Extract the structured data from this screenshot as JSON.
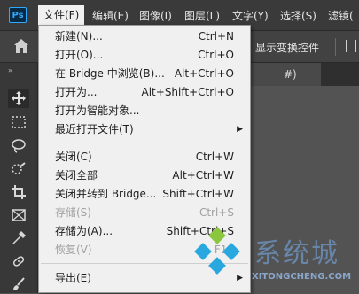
{
  "app": {
    "logo_text": "Ps",
    "menu": [
      "文件(F)",
      "编辑(E)",
      "图像(I)",
      "图层(L)",
      "文字(Y)",
      "选择(S)",
      "滤镜("
    ]
  },
  "options_bar": {
    "show_transform_controls": "显示变换控件"
  },
  "tab": {
    "label": "#)"
  },
  "file_menu": {
    "items": [
      {
        "label": "新建(N)...",
        "shortcut": "Ctrl+N",
        "disabled": false
      },
      {
        "label": "打开(O)...",
        "shortcut": "Ctrl+O",
        "disabled": false
      },
      {
        "label": "在 Bridge 中浏览(B)...",
        "shortcut": "Alt+Ctrl+O",
        "disabled": false
      },
      {
        "label": "打开为...",
        "shortcut": "Alt+Shift+Ctrl+O",
        "disabled": false
      },
      {
        "label": "打开为智能对象...",
        "shortcut": "",
        "disabled": false
      },
      {
        "label": "最近打开文件(T)",
        "shortcut": "",
        "disabled": false,
        "submenu": true
      },
      {
        "label": "关闭(C)",
        "shortcut": "Ctrl+W",
        "disabled": false
      },
      {
        "label": "关闭全部",
        "shortcut": "Alt+Ctrl+W",
        "disabled": false
      },
      {
        "label": "关闭并转到 Bridge...",
        "shortcut": "Shift+Ctrl+W",
        "disabled": false
      },
      {
        "label": "存储(S)",
        "shortcut": "Ctrl+S",
        "disabled": true
      },
      {
        "label": "存储为(A)...",
        "shortcut": "Shift+Ctrl+S",
        "disabled": false
      },
      {
        "label": "恢复(V)",
        "shortcut": "F12",
        "disabled": true
      },
      {
        "label": "导出(E)",
        "shortcut": "",
        "disabled": false,
        "submenu": true
      }
    ]
  },
  "toolbar": {
    "collapse_arrow": "»",
    "tools": [
      "move-tool",
      "marquee-tool",
      "lasso-tool",
      "quick-select-tool",
      "crop-tool",
      "frame-tool",
      "eyedropper-tool",
      "healing-brush-tool",
      "brush-tool"
    ]
  },
  "watermark": {
    "text": "系统城",
    "url": "XITONGCHENG.COM"
  },
  "colors": {
    "menubar": "#3a3a3a",
    "dropdown_bg": "#f0f0f0",
    "disabled_text": "#a0a0a0",
    "ps_blue": "#31a8ff"
  }
}
